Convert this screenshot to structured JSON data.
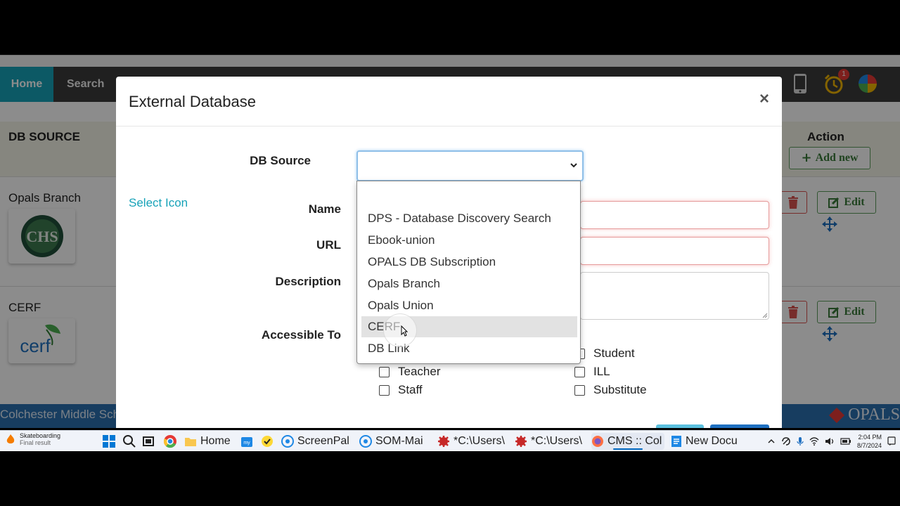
{
  "navbar": {
    "home": "Home",
    "search": "Search",
    "notification_count": "1"
  },
  "table": {
    "col_db_source": "DB SOURCE",
    "col_action": "Action",
    "add_new_label": "Add new",
    "edit_label": "Edit",
    "rows": [
      {
        "name": "Opals Branch",
        "logo_text": "CHS"
      },
      {
        "name": "CERF",
        "logo_text": "cerf"
      }
    ]
  },
  "footer": {
    "school": "Colchester Middle Sch",
    "brand": "OPALS"
  },
  "modal": {
    "title": "External Database",
    "close": "×",
    "select_icon": "Select Icon",
    "labels": {
      "db_source": "DB Source",
      "name": "Name",
      "url": "URL",
      "description": "Description",
      "accessible_to": "Accessible To"
    },
    "db_source_value": "",
    "options": [
      "",
      "DPS - Database Discovery Search",
      "Ebook-union",
      "OPALS DB Subscription",
      "Opals Branch",
      "Opals Union",
      "CERF",
      "DB Link"
    ],
    "highlighted_option": "CERF",
    "accessible": {
      "teacher": "Teacher",
      "staff": "Staff",
      "student": "Student",
      "ill": "ILL",
      "substitute": "Substitute"
    }
  },
  "taskbar": {
    "weather_title": "Skateboarding",
    "weather_sub": "Final result",
    "apps": {
      "home": "Home",
      "screenpal": "ScreenPal",
      "som": "SOM-Mai",
      "users1": "*C:\\Users\\",
      "users2": "*C:\\Users\\",
      "cms": "CMS :: Col",
      "newdoc": "New Docu"
    },
    "time": "2:04 PM",
    "date": "8/7/2024"
  },
  "colors": {
    "accent": "#17a2b8",
    "navbar": "#3b3b3b",
    "footer": "#2a6fb0",
    "edit_green": "#3a7a3a",
    "delete_red": "#d9534f"
  }
}
